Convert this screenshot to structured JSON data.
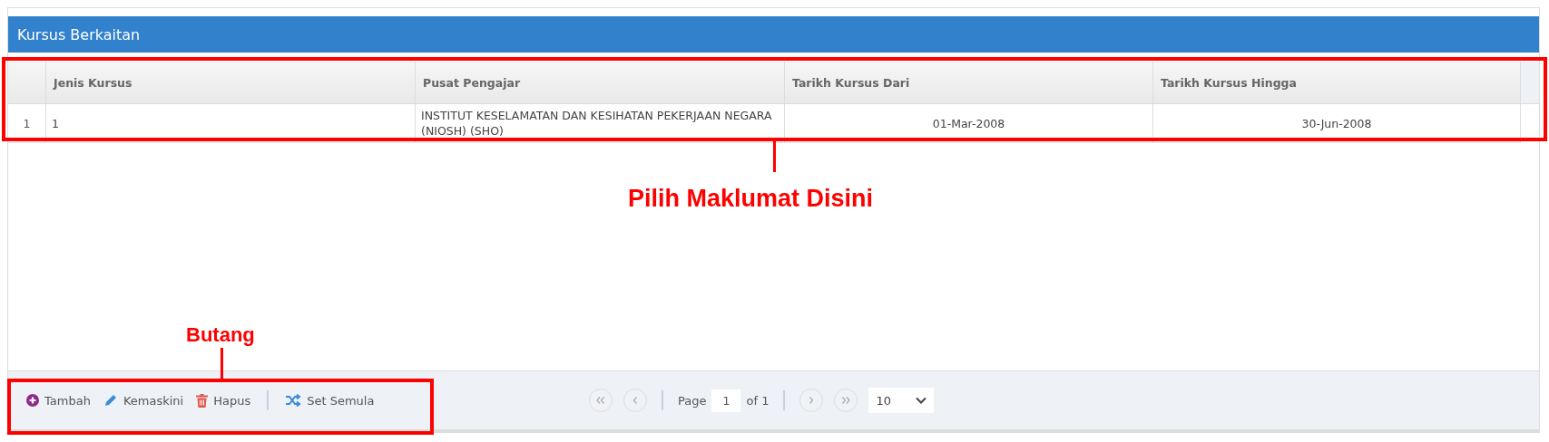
{
  "panel": {
    "title": "Kursus Berkaitan"
  },
  "table": {
    "columns": [
      "Jenis Kursus",
      "Pusat Pengajar",
      "Tarikh Kursus Dari",
      "Tarikh Kursus Hingga"
    ],
    "rows": [
      {
        "number": "1",
        "cells": [
          "1",
          "INSTITUT KESELAMATAN DAN KESIHATAN PEKERJAAN NEGARA (NIOSH) (SHO)",
          "01-Mar-2008",
          "30-Jun-2008"
        ],
        "selected": false
      }
    ]
  },
  "toolbar": [
    {
      "kind": "add",
      "label": "Tambah"
    },
    {
      "kind": "edit",
      "label": "Kemaskini"
    },
    {
      "kind": "delete",
      "label": "Hapus"
    },
    {
      "kind": "reset",
      "label": "Set Semula"
    }
  ],
  "pager": {
    "page_label": "Page",
    "page": "1",
    "of_label": "of 1",
    "page_size": "10"
  },
  "annotations": [
    {
      "kind": "table",
      "label": "Pilih Maklumat Disini"
    },
    {
      "kind": "toolbar",
      "label": "Butang"
    }
  ]
}
